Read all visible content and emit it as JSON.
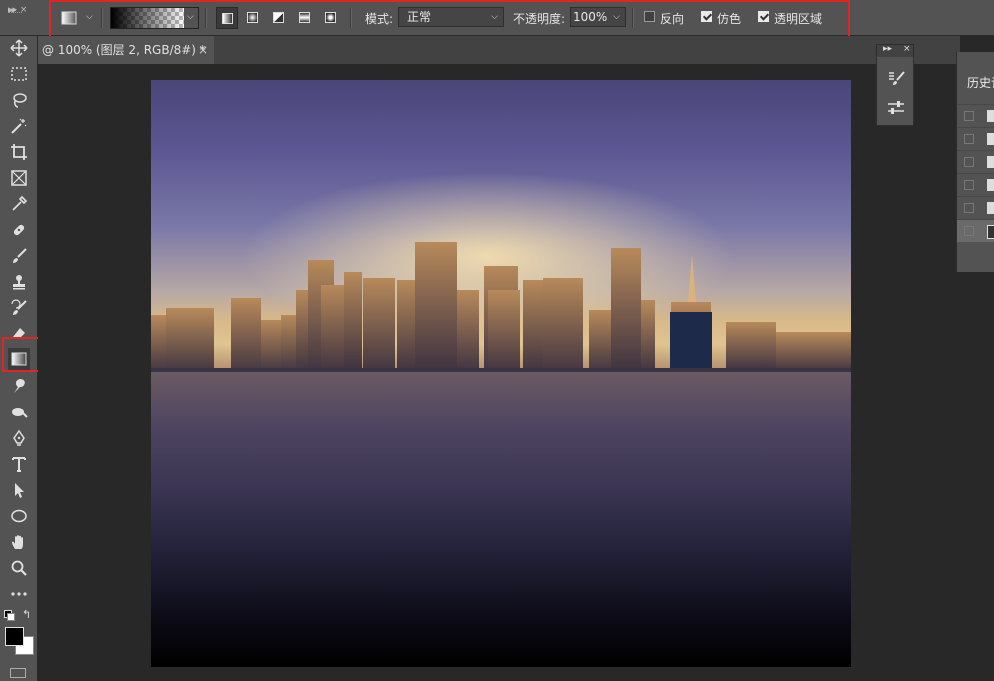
{
  "options_bar": {
    "mode_label": "模式:",
    "mode_value": "正常",
    "opacity_label": "不透明度:",
    "opacity_value": "100%",
    "reverse_label": "反向",
    "reverse_checked": false,
    "dither_label": "仿色",
    "dither_checked": true,
    "transparency_label": "透明区域",
    "transparency_checked": true
  },
  "document": {
    "tab_title": "@ 100% (图层 2, RGB/8#) *",
    "close_glyph": "×"
  },
  "history_panel": {
    "title": "历史记"
  },
  "colors": {
    "highlight": "#e22424",
    "foreground": "#000000",
    "background": "#ffffff"
  },
  "toolbar": {
    "tools": [
      "move-icon",
      "marquee-icon",
      "lasso-icon",
      "magic-wand-icon",
      "crop-icon",
      "frame-icon",
      "eyedropper-icon",
      "healing-icon",
      "brush-icon",
      "stamp-icon",
      "history-brush-icon",
      "eraser-icon",
      "gradient-icon",
      "smudge-icon",
      "dodge-icon",
      "pen-icon",
      "type-icon",
      "path-select-icon",
      "ellipse-icon",
      "hand-icon",
      "zoom-icon",
      "more-icon"
    ],
    "selected": "gradient-icon"
  }
}
